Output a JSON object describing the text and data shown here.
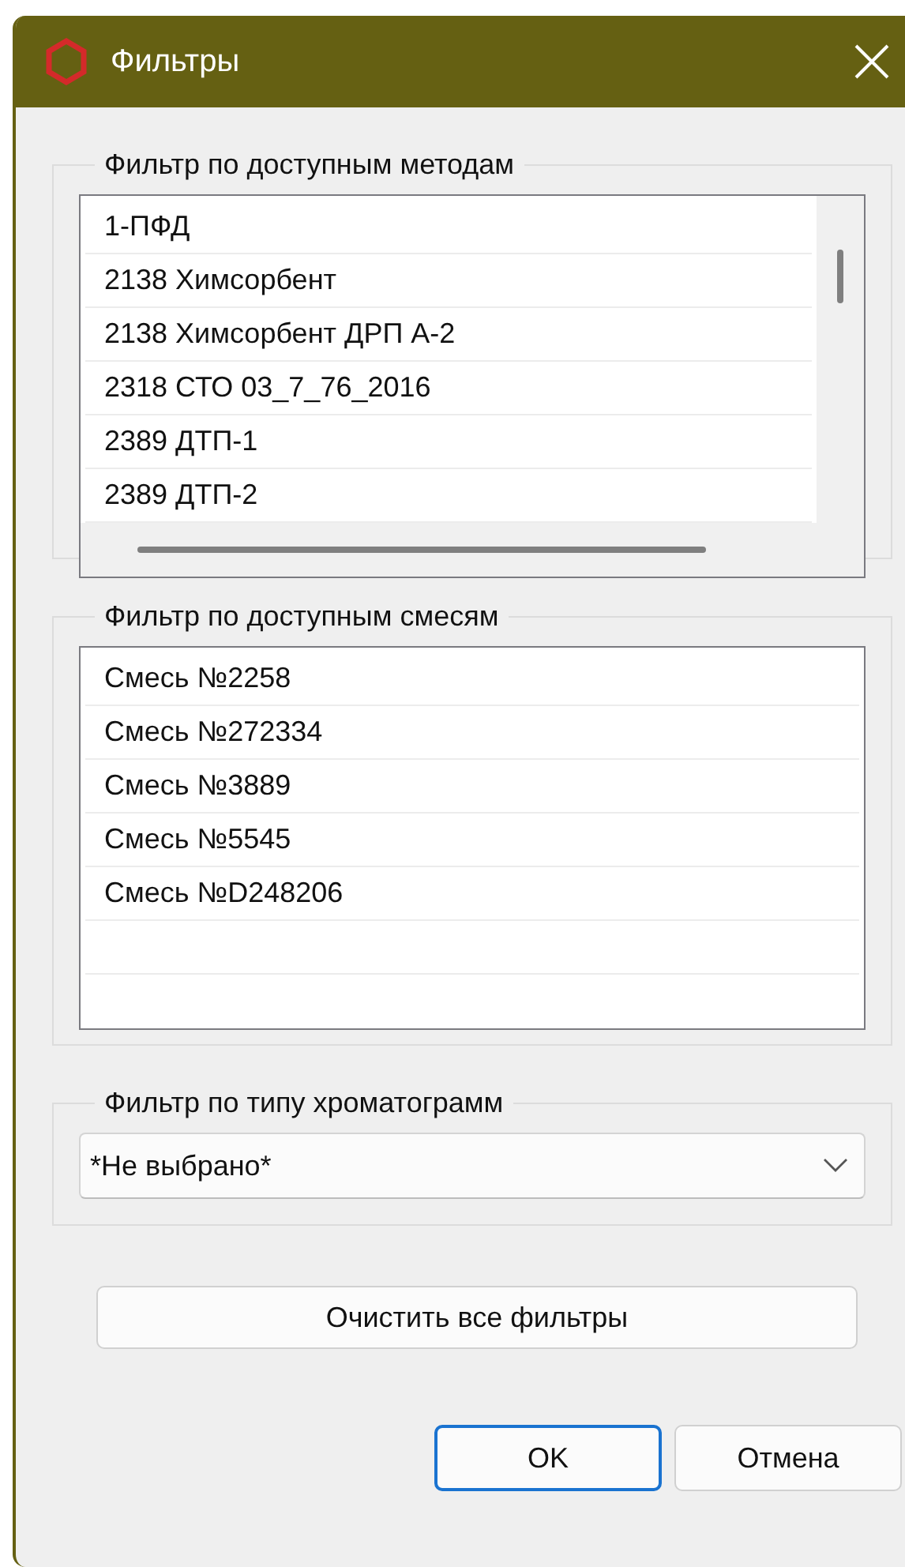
{
  "window": {
    "title": "Фильтры"
  },
  "methods_filter": {
    "label": "Фильтр по доступным методам",
    "items": [
      "1-ПФД",
      "2138 Химсорбент",
      "2138 Химсорбент ДРП А-2",
      "2318 СТО 03_7_76_2016",
      "2389 ДТП-1",
      "2389 ДТП-2"
    ]
  },
  "mixtures_filter": {
    "label": "Фильтр по доступным смесям",
    "items": [
      "Смесь №2258",
      "Смесь №272334",
      "Смесь №3889",
      "Смесь №5545",
      "Смесь №D248206"
    ]
  },
  "chromatogram_filter": {
    "label": "Фильтр по типу хроматограмм",
    "value": "*Не выбрано*"
  },
  "clear_button": "Очистить все фильтры",
  "buttons": [
    {
      "label": "OK",
      "default": true
    },
    {
      "label": "Отмена",
      "default": false
    }
  ]
}
